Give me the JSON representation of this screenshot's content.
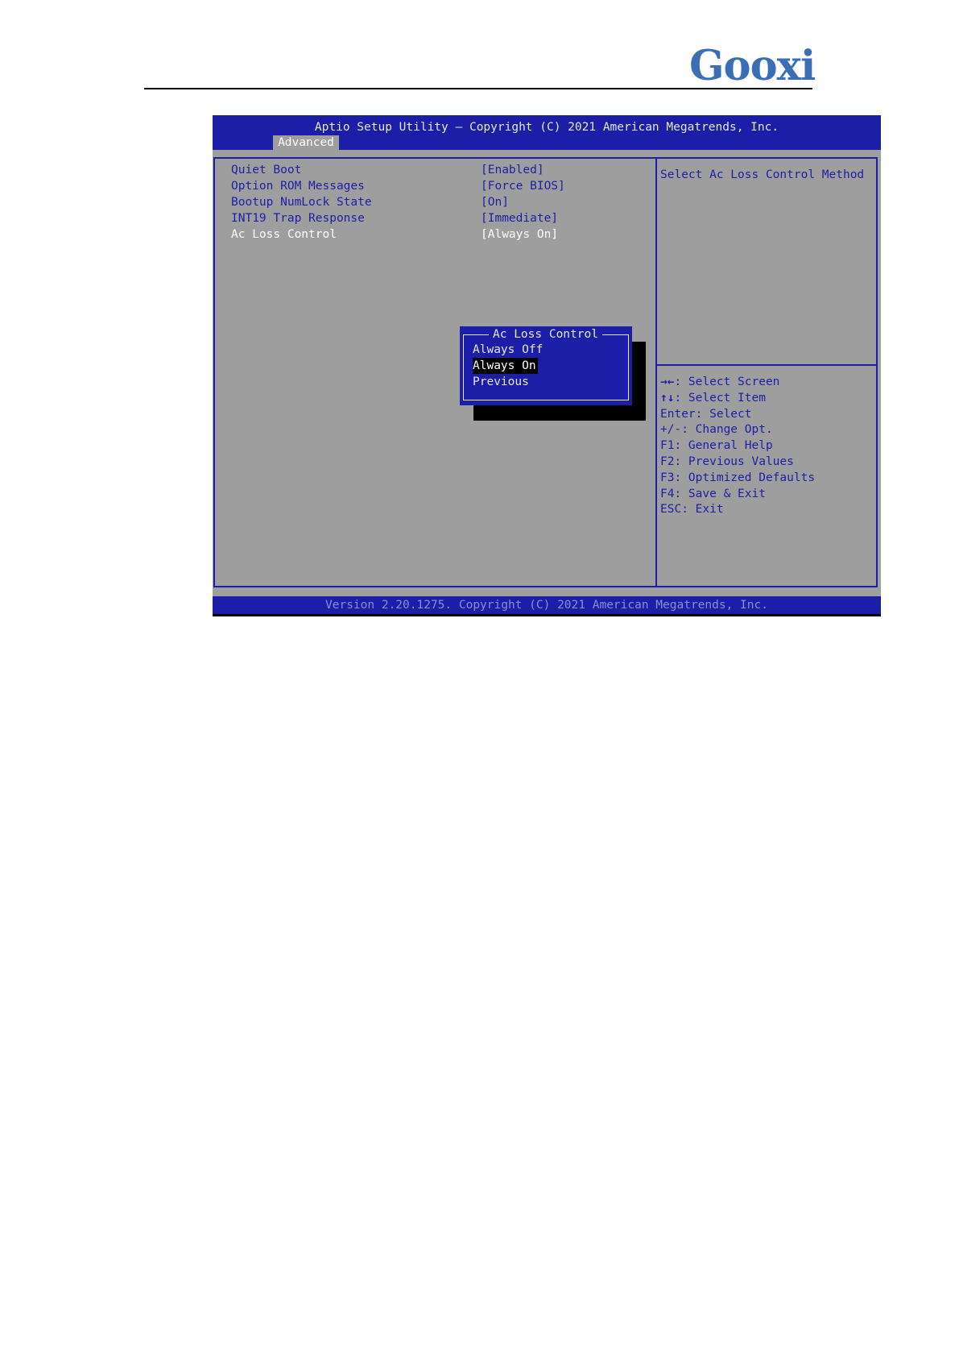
{
  "brand": {
    "logo_text": "Gooxi",
    "color": "#3a6fb6"
  },
  "bios": {
    "title": "Aptio Setup Utility – Copyright (C) 2021 American Megatrends, Inc.",
    "active_tab": "Advanced",
    "settings": [
      {
        "label": "Quiet Boot",
        "value": "[Enabled]"
      },
      {
        "label": "Option ROM Messages",
        "value": "[Force BIOS]"
      },
      {
        "label": "Bootup NumLock State",
        "value": "[On]"
      },
      {
        "label": "INT19 Trap Response",
        "value": "[Immediate]"
      },
      {
        "label": "Ac Loss Control",
        "value": "[Always On]"
      }
    ],
    "selected_setting": "Ac Loss Control",
    "help_text": "Select Ac Loss Control Method",
    "keys": [
      {
        "key": "→←",
        "desc": ": Select Screen"
      },
      {
        "key": "↑↓",
        "desc": ": Select Item"
      },
      {
        "key": "Enter",
        "desc": ": Select"
      },
      {
        "key": "+/-",
        "desc": ": Change Opt."
      },
      {
        "key": "F1",
        "desc": ": General Help"
      },
      {
        "key": "F2",
        "desc": ": Previous Values"
      },
      {
        "key": "F3",
        "desc": ": Optimized Defaults"
      },
      {
        "key": "F4",
        "desc": ": Save & Exit"
      },
      {
        "key": "ESC",
        "desc": ": Exit"
      }
    ],
    "popup": {
      "title": "Ac Loss Control",
      "options": [
        "Always Off",
        "Always On",
        "Previous"
      ],
      "selected": "Always On"
    },
    "footer": "Version 2.20.1275. Copyright (C) 2021 American Megatrends, Inc.",
    "colors": {
      "blue": "#1c1ea8",
      "gray": "#9e9e9e",
      "text_light": "#e6e6e6"
    }
  }
}
